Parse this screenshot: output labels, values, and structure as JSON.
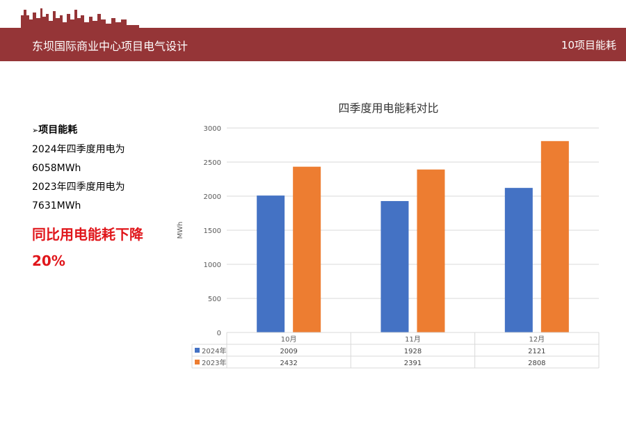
{
  "header": {
    "title": "东坝国际商业中心项目电气设计",
    "section": "10项目能耗"
  },
  "left_panel": {
    "heading": "项目能耗",
    "line1": "2024年四季度用电为",
    "line2": "6058MWh",
    "line3": "2023年四季度用电为",
    "line4": "7631MWh",
    "highlight": "同比用电能耗下降20%"
  },
  "colors": {
    "header_bg": "#953537",
    "series_2024": "#4472c4",
    "series_2023": "#ed7d31",
    "highlight": "#e0161b"
  },
  "chart_data": {
    "type": "bar",
    "title": "四季度用电能耗对比",
    "ylabel": "MWh",
    "xlabel": "",
    "categories": [
      "10月",
      "11月",
      "12月"
    ],
    "yticks": [
      "0",
      "500",
      "1000",
      "1500",
      "2000",
      "2500",
      "3000"
    ],
    "ylim": [
      0,
      3000
    ],
    "grid": true,
    "legend": "data-table",
    "series": [
      {
        "name": "2024年",
        "values": [
          2009,
          1928,
          2121
        ]
      },
      {
        "name": "2023年",
        "values": [
          2432,
          2391,
          2808
        ]
      }
    ]
  }
}
